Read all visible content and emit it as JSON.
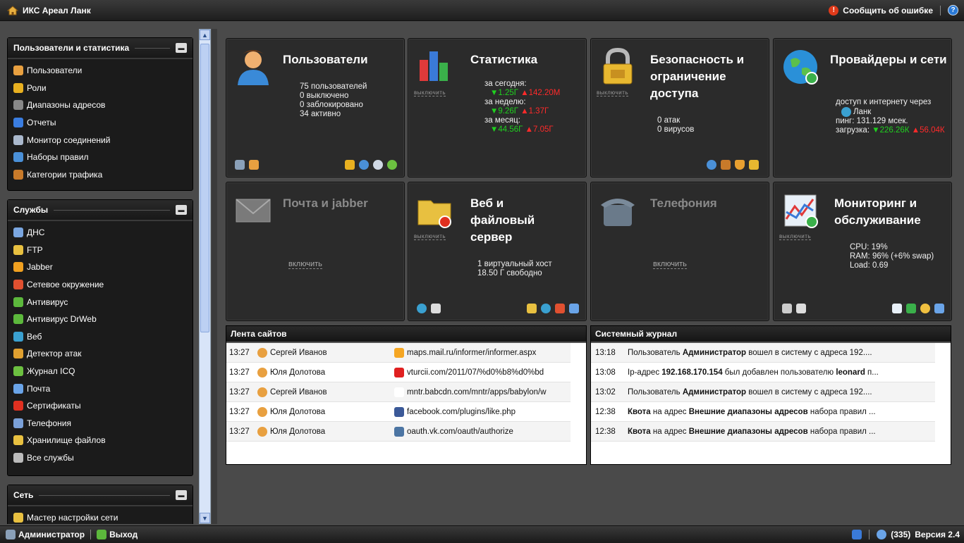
{
  "topbar": {
    "brand": "ИКС Ареал Ланк",
    "report_error": "Сообщить об ошибке"
  },
  "bottombar": {
    "user": "Администратор",
    "logout": "Выход",
    "messages": "(335)",
    "version": "Версия 2.4"
  },
  "sidebar": {
    "panels": [
      {
        "title": "Пользователи и статистика",
        "items": [
          {
            "label": "Пользователи",
            "icon": "users-icon",
            "color": "#e8a040"
          },
          {
            "label": "Роли",
            "icon": "key-icon",
            "color": "#e8b020"
          },
          {
            "label": "Диапазоны адресов",
            "icon": "address-book-icon",
            "color": "#888"
          },
          {
            "label": "Отчеты",
            "icon": "report-icon",
            "color": "#3a7de0"
          },
          {
            "label": "Монитор соединений",
            "icon": "magnifier-icon",
            "color": "#aab8cc"
          },
          {
            "label": "Наборы правил",
            "icon": "rules-icon",
            "color": "#4a90d8"
          },
          {
            "label": "Категории трафика",
            "icon": "category-icon",
            "color": "#c87a2a"
          }
        ]
      },
      {
        "title": "Службы",
        "items": [
          {
            "label": "ДНС",
            "icon": "dns-icon",
            "color": "#7aa6e0"
          },
          {
            "label": "FTP",
            "icon": "ftp-icon",
            "color": "#e8c040"
          },
          {
            "label": "Jabber",
            "icon": "jabber-icon",
            "color": "#f0a020"
          },
          {
            "label": "Сетевое окружение",
            "icon": "network-neighborhood-icon",
            "color": "#e05030"
          },
          {
            "label": "Антивирус",
            "icon": "antivirus-icon",
            "color": "#5cb83c"
          },
          {
            "label": "Антивирус DrWeb",
            "icon": "drweb-icon",
            "color": "#5cb83c"
          },
          {
            "label": "Веб",
            "icon": "web-globe-icon",
            "color": "#3aa0d0"
          },
          {
            "label": "Детектор атак",
            "icon": "attack-detector-icon",
            "color": "#e0a030"
          },
          {
            "label": "Журнал ICQ",
            "icon": "icq-icon",
            "color": "#6cc040"
          },
          {
            "label": "Почта",
            "icon": "mail-icon",
            "color": "#6aa4e8"
          },
          {
            "label": "Сертификаты",
            "icon": "certificate-icon",
            "color": "#e03020"
          },
          {
            "label": "Телефония",
            "icon": "telephony-icon",
            "color": "#7aa0d8"
          },
          {
            "label": "Хранилище файлов",
            "icon": "file-storage-icon",
            "color": "#e8c040"
          },
          {
            "label": "Все службы",
            "icon": "all-services-icon",
            "color": "#bbb"
          }
        ]
      },
      {
        "title": "Сеть",
        "items": [
          {
            "label": "Мастер настройки сети",
            "icon": "wizard-icon",
            "color": "#e8c040"
          }
        ]
      }
    ]
  },
  "tiles": {
    "users": {
      "title": "Пользователи",
      "lines": [
        "75 пользователей",
        "0 выключено",
        "0 заблокировано",
        "34 активно"
      ]
    },
    "stats": {
      "title": "Статистика",
      "toggle": "выключить",
      "today_label": "за сегодня:",
      "today_in": "▼1.25Г",
      "today_out": "▲142.20М",
      "week_label": "за неделю:",
      "week_in": "▼9.26Г",
      "week_out": "▲1.37Г",
      "month_label": "за месяц:",
      "month_in": "▼44.56Г",
      "month_out": "▲7.05Г"
    },
    "security": {
      "title": "Безопасность и ограничение доступа",
      "toggle": "выключить",
      "lines": [
        "0 атак",
        "0 вирусов"
      ]
    },
    "providers": {
      "title": "Провайдеры и сети",
      "l1": "доступ к интернету через",
      "provider": "Ланк",
      "ping": "пинг: 131.129 мсек.",
      "load_label": "загрузка:",
      "load_in": "▼226.26К",
      "load_out": "▲56.04К"
    },
    "mail": {
      "title": "Почта и jabber",
      "enable": "включить"
    },
    "web": {
      "title": "Веб и файловый сервер",
      "toggle": "выключить",
      "lines": [
        "1 виртуальный хост",
        "18.50 Г свободно"
      ]
    },
    "telephony": {
      "title": "Телефония",
      "enable": "включить"
    },
    "monitoring": {
      "title": "Мониторинг и обслуживание",
      "toggle": "выключить",
      "lines": [
        "CPU: 19%",
        "RAM: 96% (+6% swap)",
        "Load: 0.69"
      ]
    }
  },
  "sites_feed": {
    "title": "Лента сайтов",
    "rows": [
      {
        "time": "13:27",
        "user": "Сергей Иванов",
        "url": "maps.mail.ru/informer/informer.aspx",
        "favicon": "mail-ru-icon",
        "fav_color": "#f5a623"
      },
      {
        "time": "13:27",
        "user": "Юля Долотова",
        "url": "vturcii.com/2011/07/%d0%b8%d0%bd",
        "favicon": "heart-icon",
        "fav_color": "#e02020"
      },
      {
        "time": "13:27",
        "user": "Сергей Иванов",
        "url": "mntr.babcdn.com/mntr/apps/babylon/w",
        "favicon": "",
        "fav_color": "#ffffff"
      },
      {
        "time": "13:27",
        "user": "Юля Долотова",
        "url": "facebook.com/plugins/like.php",
        "favicon": "facebook-icon",
        "fav_color": "#3b5998"
      },
      {
        "time": "13:27",
        "user": "Юля Долотова",
        "url": "oauth.vk.com/oauth/authorize",
        "favicon": "vk-icon",
        "fav_color": "#4c75a3"
      }
    ]
  },
  "system_log": {
    "title": "Системный журнал",
    "rows": [
      {
        "time": "13:18",
        "parts": [
          [
            "Пользователь ",
            false
          ],
          [
            "Администратор",
            true
          ],
          [
            " вошел в систему с адреса 192....",
            false
          ]
        ]
      },
      {
        "time": "13:08",
        "parts": [
          [
            "Ip-адрес ",
            false
          ],
          [
            "192.168.170.154",
            true
          ],
          [
            " был добавлен пользователю ",
            false
          ],
          [
            "leonard",
            true
          ],
          [
            " п...",
            false
          ]
        ]
      },
      {
        "time": "13:02",
        "parts": [
          [
            "Пользователь ",
            false
          ],
          [
            "Администратор",
            true
          ],
          [
            " вошел в систему с адреса 192....",
            false
          ]
        ]
      },
      {
        "time": "12:38",
        "parts": [
          [
            "Квота",
            true
          ],
          [
            " на адрес ",
            false
          ],
          [
            "Внешние диапазоны адресов",
            true
          ],
          [
            " набора правил ...",
            false
          ]
        ]
      },
      {
        "time": "12:38",
        "parts": [
          [
            "Квота",
            true
          ],
          [
            " на адрес ",
            false
          ],
          [
            "Внешние диапазоны адресов",
            true
          ],
          [
            " набора правил ...",
            false
          ]
        ]
      }
    ]
  }
}
